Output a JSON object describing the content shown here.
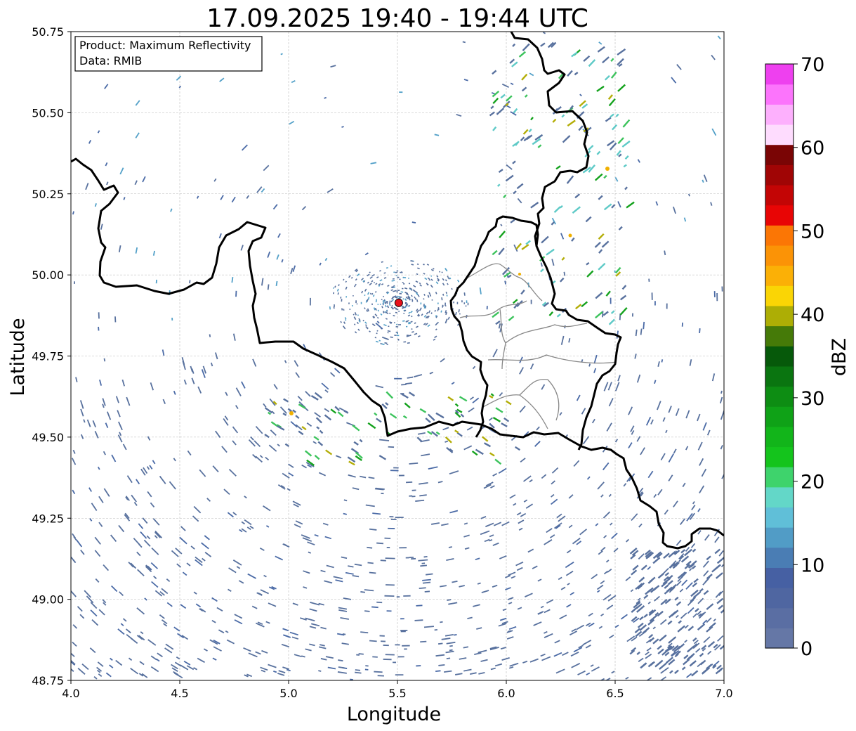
{
  "title": "17.09.2025 19:40 - 19:44 UTC",
  "info_box": {
    "product": "Product: Maximum Reflectivity",
    "source": "Data: RMIB"
  },
  "axes": {
    "xlabel": "Longitude",
    "ylabel": "Latitude",
    "xlim": [
      4.0,
      7.0
    ],
    "ylim": [
      48.75,
      50.75
    ],
    "xticks": [
      "4.0",
      "4.5",
      "5.0",
      "5.5",
      "6.0",
      "6.5",
      "7.0"
    ],
    "yticks": [
      "48.75",
      "49.00",
      "49.25",
      "49.50",
      "49.75",
      "50.00",
      "50.25",
      "50.50",
      "50.75"
    ],
    "grid": true
  },
  "radar_site": {
    "lon": 5.506,
    "lat": 49.914,
    "color": "#e8101a"
  },
  "colorbar": {
    "label": "dBZ",
    "range": [
      0,
      70
    ],
    "ticks": [
      "0",
      "10",
      "20",
      "30",
      "40",
      "50",
      "60",
      "70"
    ],
    "colors": [
      "#6577a6",
      "#5a6ea3",
      "#4f66a1",
      "#4660a3",
      "#4a7db4",
      "#519cc6",
      "#60bfd8",
      "#63d7c8",
      "#3ed36c",
      "#14c41c",
      "#12b51a",
      "#0fa217",
      "#0d8d13",
      "#0a7510",
      "#06590a",
      "#457a08",
      "#adae05",
      "#fad505",
      "#fbb006",
      "#fb9306",
      "#fb7605",
      "#e80505",
      "#c30505",
      "#a00505",
      "#7a0505",
      "#fedcfe",
      "#fdb0fd",
      "#fc74fc",
      "#ee40ef"
    ]
  },
  "map": {
    "border_color": "#000000",
    "district_color": "#888888",
    "echo_colors": [
      "#58719e",
      "#4a6aa6",
      "#52a0c8",
      "#5ecac7",
      "#3cc35c",
      "#14a21d",
      "#0e8a18",
      "#b3ad06",
      "#f0b000"
    ]
  }
}
